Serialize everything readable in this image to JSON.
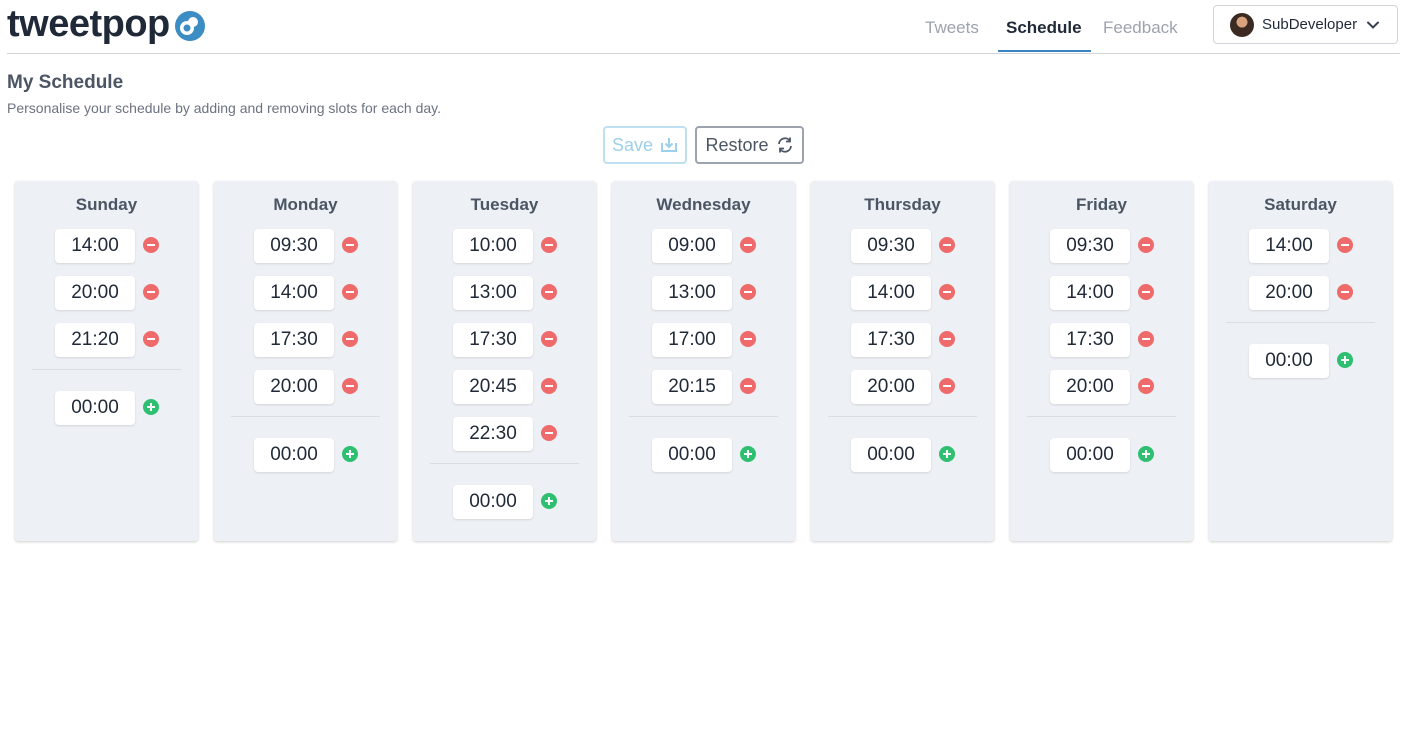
{
  "app": {
    "name": "tweetpop"
  },
  "nav": {
    "tweets": "Tweets",
    "schedule": "Schedule",
    "feedback": "Feedback"
  },
  "user": {
    "name": "SubDeveloper"
  },
  "page": {
    "title": "My Schedule",
    "subtitle": "Personalise your schedule by adding and removing slots for each day."
  },
  "actions": {
    "save": "Save",
    "restore": "Restore"
  },
  "colors": {
    "accent": "#3b82c4",
    "remove": "#ef6b6b",
    "add": "#2fbf71"
  },
  "days": [
    {
      "name": "Sunday",
      "slots": [
        "14:00",
        "20:00",
        "21:20"
      ],
      "new_slot": "00:00"
    },
    {
      "name": "Monday",
      "slots": [
        "09:30",
        "14:00",
        "17:30",
        "20:00"
      ],
      "new_slot": "00:00"
    },
    {
      "name": "Tuesday",
      "slots": [
        "10:00",
        "13:00",
        "17:30",
        "20:45",
        "22:30"
      ],
      "new_slot": "00:00"
    },
    {
      "name": "Wednesday",
      "slots": [
        "09:00",
        "13:00",
        "17:00",
        "20:15"
      ],
      "new_slot": "00:00"
    },
    {
      "name": "Thursday",
      "slots": [
        "09:30",
        "14:00",
        "17:30",
        "20:00"
      ],
      "new_slot": "00:00"
    },
    {
      "name": "Friday",
      "slots": [
        "09:30",
        "14:00",
        "17:30",
        "20:00"
      ],
      "new_slot": "00:00"
    },
    {
      "name": "Saturday",
      "slots": [
        "14:00",
        "20:00"
      ],
      "new_slot": "00:00"
    }
  ]
}
